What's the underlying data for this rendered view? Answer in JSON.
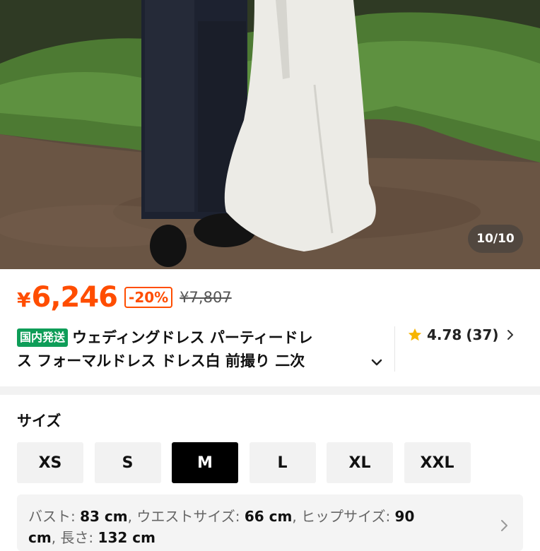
{
  "gallery": {
    "counter": "10/10"
  },
  "price": {
    "current": "6,246",
    "currency": "¥",
    "discount": "-20%",
    "original": "¥7,807",
    "accent_color": "#ff4d00"
  },
  "product": {
    "badge": "国内発送",
    "badge_color": "#0e9d58",
    "title_line1": "ウェディングドレス パーティードレ",
    "title_line2": "ス フォーマルドレス ドレス白 前撮り 二次",
    "expand_icon": "chevron-down-icon"
  },
  "rating": {
    "score": "4.78",
    "count": "(37)",
    "icon": "star-icon"
  },
  "size": {
    "label": "サイズ",
    "options": [
      "XS",
      "S",
      "M",
      "L",
      "XL",
      "XXL"
    ],
    "selected": "M"
  },
  "measurements": {
    "bust_label": "バスト:",
    "bust_value": "83 cm",
    "waist_label": "ウエストサイズ:",
    "waist_value": "66 cm",
    "hip_label": "ヒップサイズ:",
    "hip_value": "90",
    "hip_unit": "cm",
    "length_label": "長さ:",
    "length_value": "132 cm",
    "sep": ","
  }
}
